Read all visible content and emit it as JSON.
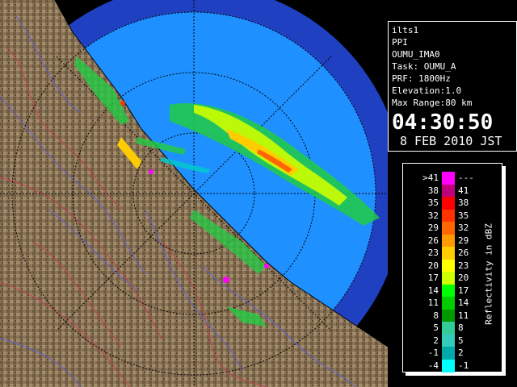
{
  "info": {
    "site": "ilts1",
    "product": "PPI",
    "station": "OUMU_IMA0",
    "task": "Task: OUMU_A",
    "prf": "PRF: 1800Hz",
    "elevation": "Elevation:1.0",
    "max_range": "Max Range:80 km",
    "time": "04:30:50",
    "date": "8 FEB 2010 JST"
  },
  "legend": {
    "axis_label": "Reflectivity in dBZ",
    "rows": [
      {
        "left": ">41",
        "right": "---",
        "color": "#ff00ff"
      },
      {
        "left": "38",
        "right": "41",
        "color": "#c0007a"
      },
      {
        "left": "35",
        "right": "38",
        "color": "#ff0000"
      },
      {
        "left": "32",
        "right": "35",
        "color": "#ff3300"
      },
      {
        "left": "29",
        "right": "32",
        "color": "#ff6600"
      },
      {
        "left": "26",
        "right": "29",
        "color": "#ff9900"
      },
      {
        "left": "23",
        "right": "26",
        "color": "#ffcc00"
      },
      {
        "left": "20",
        "right": "23",
        "color": "#ffff00"
      },
      {
        "left": "17",
        "right": "20",
        "color": "#ccff00"
      },
      {
        "left": "14",
        "right": "17",
        "color": "#00ff00"
      },
      {
        "left": "11",
        "right": "14",
        "color": "#00cc00"
      },
      {
        "left": "8",
        "right": "11",
        "color": "#009900"
      },
      {
        "left": "5",
        "right": "8",
        "color": "#33cc99"
      },
      {
        "left": "2",
        "right": "5",
        "color": "#33ccbb"
      },
      {
        "left": "-1",
        "right": "2",
        "color": "#00aaaa"
      },
      {
        "left": "-4",
        "right": "-1",
        "color": "#00ffff"
      }
    ]
  },
  "colors": {
    "range_ring_outer": "#1f3fbf",
    "radar_coverage": "#1e90ff",
    "land": "#8a7255",
    "background": "#000000"
  }
}
